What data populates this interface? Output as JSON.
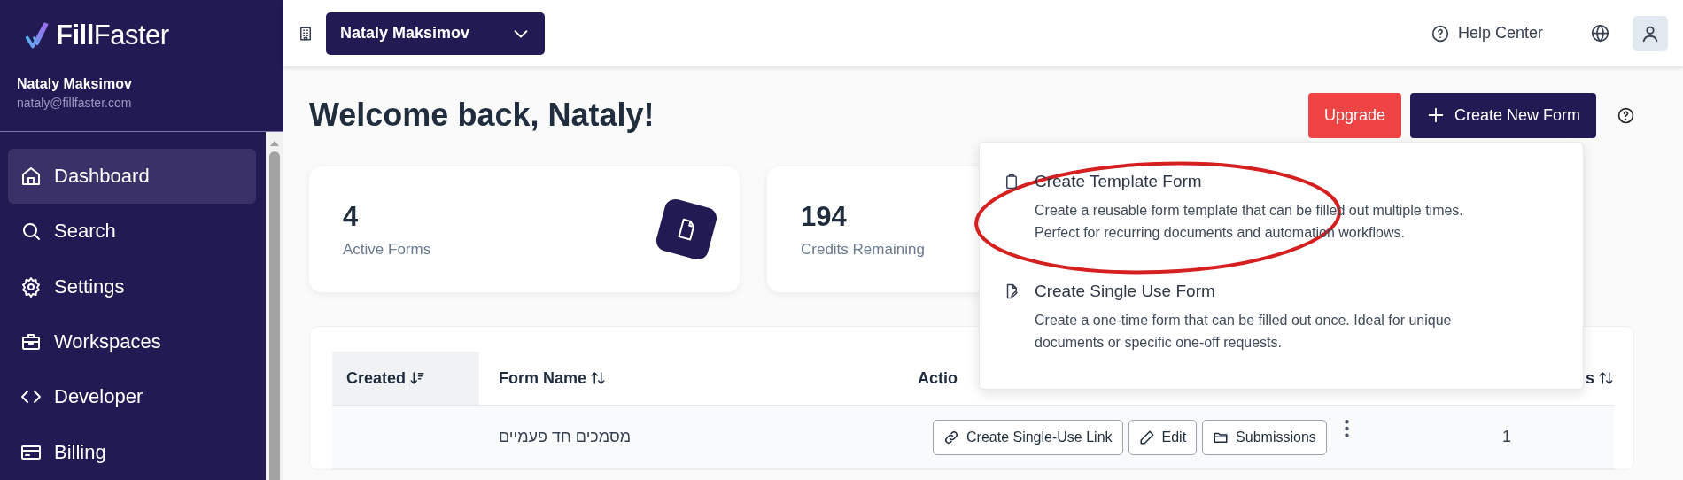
{
  "sidebar": {
    "logo": "**Fill**Faster",
    "user_name": "Nataly Maksimov",
    "email": "nataly@fillfaster.com",
    "items": [
      {
        "label": "Dashboard",
        "selected": true
      },
      {
        "label": "Search",
        "selected": false
      },
      {
        "label": "Settings",
        "selected": false
      },
      {
        "label": "Workspaces",
        "selected": false
      },
      {
        "label": "Developer",
        "selected": false
      },
      {
        "label": "Billing",
        "selected": false
      }
    ]
  },
  "topbar": {
    "workspace": "Nataly Maksimov",
    "help": "Help Center"
  },
  "page": {
    "title": "Welcome back, Nataly!",
    "buttons": [
      {
        "label": "Upgrade",
        "kind": "danger"
      },
      {
        "label": "Create New Form",
        "kind": "primary"
      }
    ]
  },
  "stats": [
    {
      "value": "4",
      "label": "Active Forms"
    },
    {
      "value": "194",
      "label": "Credits Remaining"
    }
  ],
  "create_menu": {
    "items": [
      {
        "title": "Create Template Form",
        "description": "Create a reusable form template that can be filled out multiple times. Perfect for recurring documents and automation workflows."
      },
      {
        "title": "Create Single Use Form",
        "description": "Create a one-time form that can be filled out once. Ideal for unique documents or specific one-off requests."
      }
    ]
  },
  "table": {
    "columns": [
      {
        "label": "Created",
        "sorted": true
      },
      {
        "label": "Form Name",
        "sorted": false
      },
      {
        "label": "Actio",
        "sorted": false
      },
      {
        "label": "s",
        "sorted": false
      }
    ],
    "rows": [
      {
        "form_name": "מסמכים חד פעמיים",
        "actions": [
          "Create Single-Use Link",
          "Edit",
          "Submissions"
        ],
        "column_4": "1"
      }
    ]
  }
}
